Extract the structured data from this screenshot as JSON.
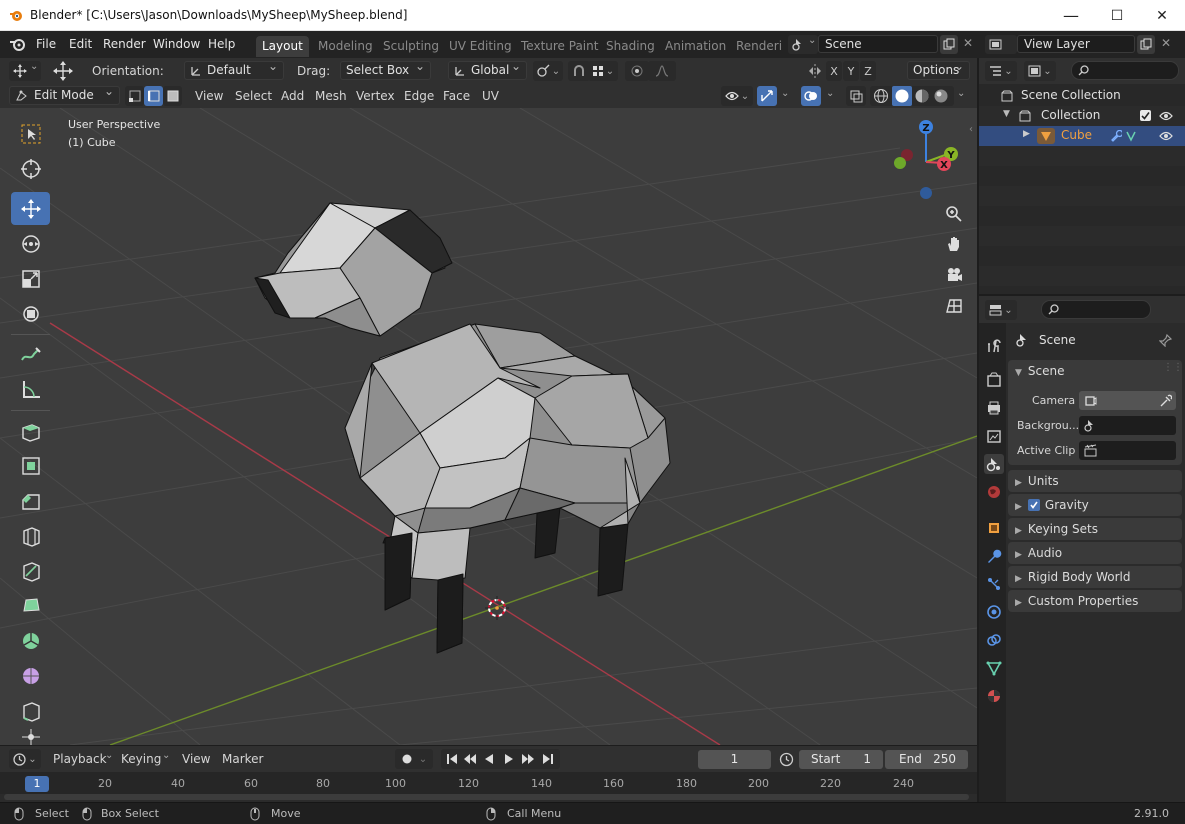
{
  "window": {
    "title": "Blender* [C:\\Users\\Jason\\Downloads\\MySheep\\MySheep.blend]",
    "minimize": "—",
    "maximize": "☐",
    "close": "✕"
  },
  "menu": [
    "File",
    "Edit",
    "Render",
    "Window",
    "Help"
  ],
  "workspaces": [
    "Layout",
    "Modeling",
    "Sculpting",
    "UV Editing",
    "Texture Paint",
    "Shading",
    "Animation",
    "Renderir"
  ],
  "active_workspace": "Layout",
  "scene_name": "Scene",
  "view_layer": "View Layer",
  "tool_header": {
    "orientation_label": "Orientation:",
    "orientation_value": "Default",
    "drag_label": "Drag:",
    "drag_value": "Select Box",
    "transform_value": "Global",
    "axes": [
      "X",
      "Y",
      "Z"
    ],
    "options": "Options"
  },
  "editor_header": {
    "mode": "Edit Mode",
    "menus": [
      "View",
      "Select",
      "Add",
      "Mesh",
      "Vertex",
      "Edge",
      "Face",
      "UV"
    ]
  },
  "viewport": {
    "perspective": "User Perspective",
    "object": "(1) Cube",
    "gizmo": {
      "z": "Z",
      "y": "Y",
      "x": "X"
    }
  },
  "outliner": {
    "search_placeholder": "",
    "rows": [
      {
        "label": "Scene Collection"
      },
      {
        "label": "Collection"
      },
      {
        "label": "Cube"
      }
    ]
  },
  "properties": {
    "breadcrumb": "Scene",
    "panel_title": "Scene",
    "camera_label": "Camera",
    "background_label": "Backgrou...",
    "active_clip_label": "Active Clip",
    "sections": [
      "Units",
      "Gravity",
      "Keying Sets",
      "Audio",
      "Rigid Body World",
      "Custom Properties"
    ],
    "gravity_checked": true
  },
  "timeline": {
    "menus": [
      "Playback",
      "Keying",
      "View",
      "Marker"
    ],
    "current_frame": "1",
    "start_label": "Start",
    "start_value": "1",
    "end_label": "End",
    "end_value": "250",
    "ruler": [
      "1",
      "20",
      "40",
      "60",
      "80",
      "100",
      "120",
      "140",
      "160",
      "180",
      "200",
      "220",
      "240"
    ]
  },
  "statusbar": {
    "select": "Select",
    "box_select": "Box Select",
    "move": "Move",
    "call_menu": "Call Menu",
    "version": "2.91.0"
  },
  "colors": {
    "accent": "#4772b3",
    "axis_x": "#e2465a",
    "axis_y": "#8ab526",
    "axis_z": "#3d82e0",
    "object_orange": "#f0a040"
  }
}
